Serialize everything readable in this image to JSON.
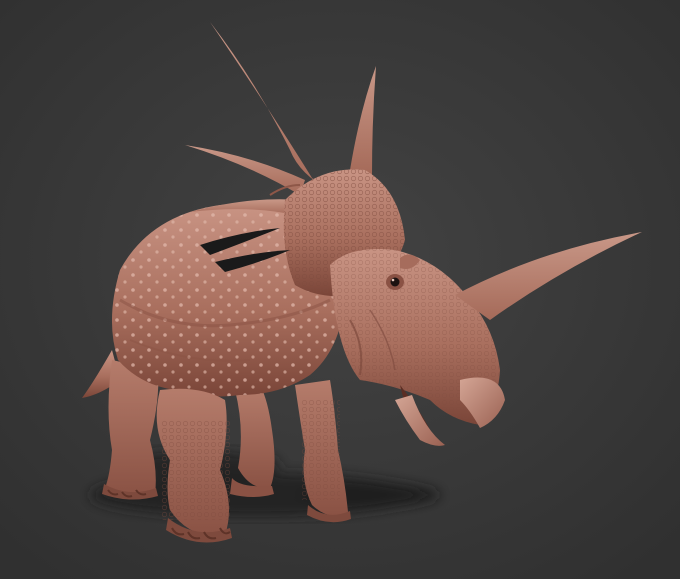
{
  "viewport": {
    "background": "#3a3a3a",
    "model_colors": {
      "skin_light": "#c28a7a",
      "skin_mid": "#a9705f",
      "skin_dark": "#6e3f33",
      "shadow": "#1a1a1a"
    }
  },
  "render": {
    "subject": "styracosaurus-sculpt",
    "style": "clay-render"
  }
}
